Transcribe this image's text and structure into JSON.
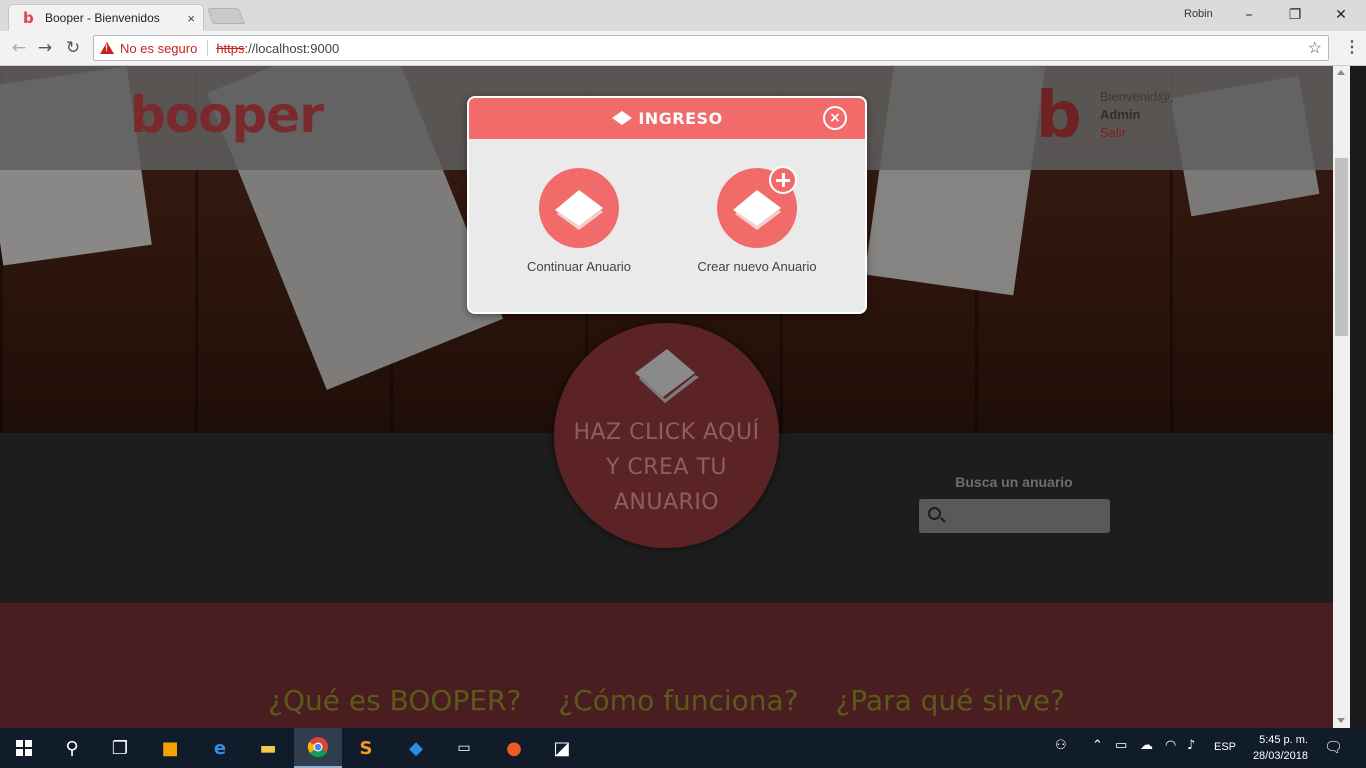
{
  "browser": {
    "tab_title": "Booper - Bienvenidos",
    "tab_close": "×",
    "profile_name": "Robin",
    "security_label": "No es seguro",
    "url_scheme": "https",
    "url_rest": "://localhost:9000"
  },
  "header": {
    "logo_text": "booper",
    "mark_text": "b",
    "welcome_line": "Bienvenid@,",
    "user_name": "Admin",
    "logout_label": "Salir"
  },
  "hero": {
    "cta_line1": "HAZ CLICK AQUÍ",
    "cta_line2": "Y CREA TU",
    "cta_line3": "ANUARIO"
  },
  "search": {
    "label": "Busca un anuario",
    "placeholder": ""
  },
  "info_links": [
    "¿Qué es BOOPER?",
    "¿Cómo funciona?",
    "¿Para qué sirve?"
  ],
  "modal": {
    "title": "INGRESO",
    "close_glyph": "×",
    "option_continue": "Continuar Anuario",
    "option_create": "Crear nuevo Anuario"
  },
  "taskbar": {
    "language": "ESP",
    "time": "5:45 p. m.",
    "date": "28/03/2018"
  },
  "colors": {
    "brand": "#f26b6b",
    "brand_dark": "#5c2326"
  }
}
